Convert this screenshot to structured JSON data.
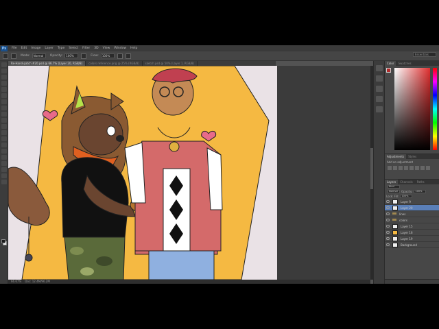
{
  "app": {
    "logo": "Ps",
    "menus": [
      "File",
      "Edit",
      "Image",
      "Layer",
      "Type",
      "Select",
      "Filter",
      "3D",
      "View",
      "Window",
      "Help"
    ],
    "workspace": "Essentials"
  },
  "options": {
    "mode_label": "Mode:",
    "mode_value": "Normal",
    "opacity_label": "Opacity:",
    "opacity_value": "100%",
    "flow_label": "Flow:",
    "flow_value": "100%"
  },
  "tabs": [
    {
      "label": "Re-Hand-patch #20.psd @ 66.7% (Layer 20, RGB/8)",
      "active": true
    },
    {
      "label": "colors reference.png @ 25% (RGB/8)",
      "active": false
    },
    {
      "label": "sketch.psd @ 50% (Layer 1, RGB/8)",
      "active": false
    }
  ],
  "status": {
    "zoom": "66.67%",
    "doc": "Doc: 12.4M/96.2M"
  },
  "panels": {
    "color_tabs": [
      "Color",
      "Swatches"
    ],
    "adjust_tabs": [
      "Adjustments",
      "Styles"
    ],
    "adjust_title": "Add an adjustment",
    "layer_tabs": [
      "Layers",
      "Channels",
      "Paths"
    ],
    "kind_label": "Kind",
    "blend_mode": "Normal",
    "opacity_label": "Opacity:",
    "opacity_value": "100%",
    "lock_label": "Lock:",
    "fill_label": "Fill:",
    "fill_value": "100%",
    "layers": [
      {
        "name": "Layer 9",
        "thumb": "white",
        "selected": false
      },
      {
        "name": "Layer 20",
        "thumb": "white",
        "selected": true
      },
      {
        "name": "lines",
        "thumb": "folder",
        "selected": false
      },
      {
        "name": "colors",
        "thumb": "folder",
        "selected": false
      },
      {
        "name": "Layer 15",
        "thumb": "white",
        "selected": false
      },
      {
        "name": "Layer 16",
        "thumb": "orange",
        "selected": false
      },
      {
        "name": "Layer 19",
        "thumb": "white",
        "selected": false
      },
      {
        "name": "Background",
        "thumb": "white",
        "selected": false
      }
    ]
  },
  "colors": {
    "app_bg": "#535353",
    "canvas_bg": "#eae2e6",
    "accent_yellow": "#f5b942",
    "selected_layer": "#5a7fb8"
  }
}
